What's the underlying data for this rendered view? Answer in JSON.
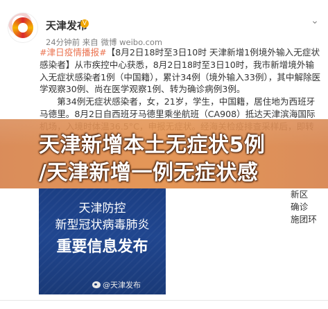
{
  "post": {
    "user_name": "天津发布",
    "meta": "24分钟前 来自 微博 weibo.com",
    "hashtag": "#津日疫情播报#",
    "paragraph1_rest": "【8月2日18时至3日10时 天津新增1例境外输入无症状感染者】从市疾控中心获悉，8月2日18时至3日10时，我市新增境外输入无症状感染者1例（中国籍），累计34例（境外输入33例），其中解除医学观察30例、尚在医学观察1例、转为确诊病例3例。",
    "paragraph2": "第34例无症状感染者，女，21岁，学生，中国籍，居住地为西班牙马德里。8月2日自西班牙马德里乘坐航班（CA908）抵达天津滨海国际机场，入境时体温36.5°C，申报无症状。经海关检疫排查采样后，即转运至滨海新区隔离点",
    "right_snippets": [
      "8月2日",
      "，诊断为无",
      "境外输"
    ],
    "right_snippet_lines": [
      "新区",
      "确诊",
      "施团环"
    ]
  },
  "banner": {
    "line1": "天津新增本土无症状5例",
    "line2": "/天津新增一例无症状感"
  },
  "image": {
    "line1": "天津防控",
    "line2": "新型冠状病毒肺炎",
    "line3": "重要信息发布",
    "watermark": "@天津发布"
  },
  "colors": {
    "hashtag": "#eb7350",
    "banner": "#dc8a48",
    "image_bg": "#1f4289"
  }
}
